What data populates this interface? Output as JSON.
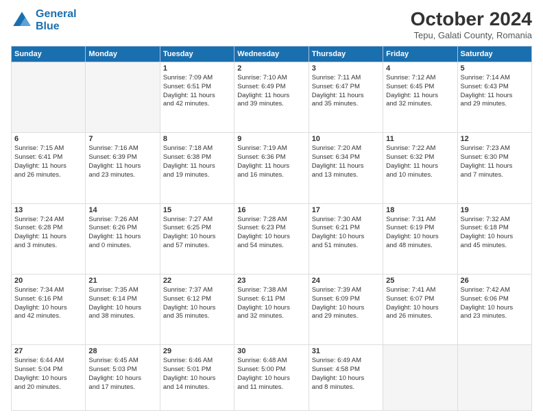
{
  "header": {
    "logo_line1": "General",
    "logo_line2": "Blue",
    "month_year": "October 2024",
    "location": "Tepu, Galati County, Romania"
  },
  "days_of_week": [
    "Sunday",
    "Monday",
    "Tuesday",
    "Wednesday",
    "Thursday",
    "Friday",
    "Saturday"
  ],
  "weeks": [
    [
      {
        "day": "",
        "lines": []
      },
      {
        "day": "",
        "lines": []
      },
      {
        "day": "1",
        "lines": [
          "Sunrise: 7:09 AM",
          "Sunset: 6:51 PM",
          "Daylight: 11 hours",
          "and 42 minutes."
        ]
      },
      {
        "day": "2",
        "lines": [
          "Sunrise: 7:10 AM",
          "Sunset: 6:49 PM",
          "Daylight: 11 hours",
          "and 39 minutes."
        ]
      },
      {
        "day": "3",
        "lines": [
          "Sunrise: 7:11 AM",
          "Sunset: 6:47 PM",
          "Daylight: 11 hours",
          "and 35 minutes."
        ]
      },
      {
        "day": "4",
        "lines": [
          "Sunrise: 7:12 AM",
          "Sunset: 6:45 PM",
          "Daylight: 11 hours",
          "and 32 minutes."
        ]
      },
      {
        "day": "5",
        "lines": [
          "Sunrise: 7:14 AM",
          "Sunset: 6:43 PM",
          "Daylight: 11 hours",
          "and 29 minutes."
        ]
      }
    ],
    [
      {
        "day": "6",
        "lines": [
          "Sunrise: 7:15 AM",
          "Sunset: 6:41 PM",
          "Daylight: 11 hours",
          "and 26 minutes."
        ]
      },
      {
        "day": "7",
        "lines": [
          "Sunrise: 7:16 AM",
          "Sunset: 6:39 PM",
          "Daylight: 11 hours",
          "and 23 minutes."
        ]
      },
      {
        "day": "8",
        "lines": [
          "Sunrise: 7:18 AM",
          "Sunset: 6:38 PM",
          "Daylight: 11 hours",
          "and 19 minutes."
        ]
      },
      {
        "day": "9",
        "lines": [
          "Sunrise: 7:19 AM",
          "Sunset: 6:36 PM",
          "Daylight: 11 hours",
          "and 16 minutes."
        ]
      },
      {
        "day": "10",
        "lines": [
          "Sunrise: 7:20 AM",
          "Sunset: 6:34 PM",
          "Daylight: 11 hours",
          "and 13 minutes."
        ]
      },
      {
        "day": "11",
        "lines": [
          "Sunrise: 7:22 AM",
          "Sunset: 6:32 PM",
          "Daylight: 11 hours",
          "and 10 minutes."
        ]
      },
      {
        "day": "12",
        "lines": [
          "Sunrise: 7:23 AM",
          "Sunset: 6:30 PM",
          "Daylight: 11 hours",
          "and 7 minutes."
        ]
      }
    ],
    [
      {
        "day": "13",
        "lines": [
          "Sunrise: 7:24 AM",
          "Sunset: 6:28 PM",
          "Daylight: 11 hours",
          "and 3 minutes."
        ]
      },
      {
        "day": "14",
        "lines": [
          "Sunrise: 7:26 AM",
          "Sunset: 6:26 PM",
          "Daylight: 11 hours",
          "and 0 minutes."
        ]
      },
      {
        "day": "15",
        "lines": [
          "Sunrise: 7:27 AM",
          "Sunset: 6:25 PM",
          "Daylight: 10 hours",
          "and 57 minutes."
        ]
      },
      {
        "day": "16",
        "lines": [
          "Sunrise: 7:28 AM",
          "Sunset: 6:23 PM",
          "Daylight: 10 hours",
          "and 54 minutes."
        ]
      },
      {
        "day": "17",
        "lines": [
          "Sunrise: 7:30 AM",
          "Sunset: 6:21 PM",
          "Daylight: 10 hours",
          "and 51 minutes."
        ]
      },
      {
        "day": "18",
        "lines": [
          "Sunrise: 7:31 AM",
          "Sunset: 6:19 PM",
          "Daylight: 10 hours",
          "and 48 minutes."
        ]
      },
      {
        "day": "19",
        "lines": [
          "Sunrise: 7:32 AM",
          "Sunset: 6:18 PM",
          "Daylight: 10 hours",
          "and 45 minutes."
        ]
      }
    ],
    [
      {
        "day": "20",
        "lines": [
          "Sunrise: 7:34 AM",
          "Sunset: 6:16 PM",
          "Daylight: 10 hours",
          "and 42 minutes."
        ]
      },
      {
        "day": "21",
        "lines": [
          "Sunrise: 7:35 AM",
          "Sunset: 6:14 PM",
          "Daylight: 10 hours",
          "and 38 minutes."
        ]
      },
      {
        "day": "22",
        "lines": [
          "Sunrise: 7:37 AM",
          "Sunset: 6:12 PM",
          "Daylight: 10 hours",
          "and 35 minutes."
        ]
      },
      {
        "day": "23",
        "lines": [
          "Sunrise: 7:38 AM",
          "Sunset: 6:11 PM",
          "Daylight: 10 hours",
          "and 32 minutes."
        ]
      },
      {
        "day": "24",
        "lines": [
          "Sunrise: 7:39 AM",
          "Sunset: 6:09 PM",
          "Daylight: 10 hours",
          "and 29 minutes."
        ]
      },
      {
        "day": "25",
        "lines": [
          "Sunrise: 7:41 AM",
          "Sunset: 6:07 PM",
          "Daylight: 10 hours",
          "and 26 minutes."
        ]
      },
      {
        "day": "26",
        "lines": [
          "Sunrise: 7:42 AM",
          "Sunset: 6:06 PM",
          "Daylight: 10 hours",
          "and 23 minutes."
        ]
      }
    ],
    [
      {
        "day": "27",
        "lines": [
          "Sunrise: 6:44 AM",
          "Sunset: 5:04 PM",
          "Daylight: 10 hours",
          "and 20 minutes."
        ]
      },
      {
        "day": "28",
        "lines": [
          "Sunrise: 6:45 AM",
          "Sunset: 5:03 PM",
          "Daylight: 10 hours",
          "and 17 minutes."
        ]
      },
      {
        "day": "29",
        "lines": [
          "Sunrise: 6:46 AM",
          "Sunset: 5:01 PM",
          "Daylight: 10 hours",
          "and 14 minutes."
        ]
      },
      {
        "day": "30",
        "lines": [
          "Sunrise: 6:48 AM",
          "Sunset: 5:00 PM",
          "Daylight: 10 hours",
          "and 11 minutes."
        ]
      },
      {
        "day": "31",
        "lines": [
          "Sunrise: 6:49 AM",
          "Sunset: 4:58 PM",
          "Daylight: 10 hours",
          "and 8 minutes."
        ]
      },
      {
        "day": "",
        "lines": []
      },
      {
        "day": "",
        "lines": []
      }
    ]
  ]
}
